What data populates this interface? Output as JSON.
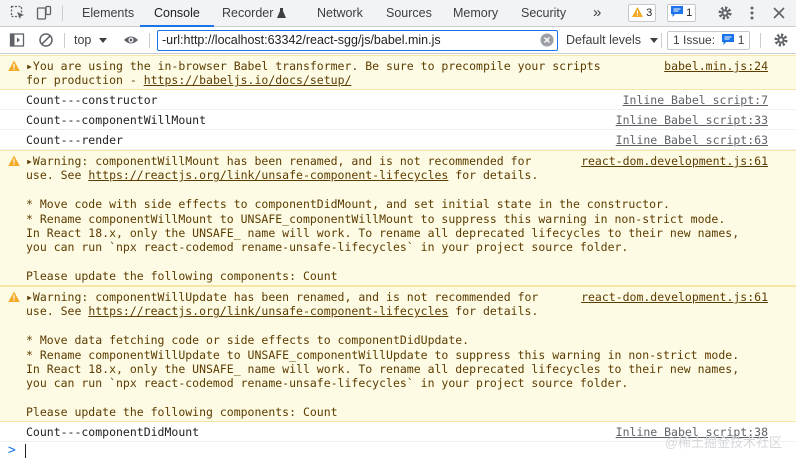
{
  "tabs": [
    {
      "label": "Elements"
    },
    {
      "label": "Console"
    },
    {
      "label": "Recorder"
    },
    {
      "label": "Network"
    },
    {
      "label": "Sources"
    },
    {
      "label": "Memory"
    },
    {
      "label": "Security"
    }
  ],
  "badges": {
    "warnings": "3",
    "messages": "1"
  },
  "toolbar": {
    "context": "top",
    "filter_value": "-url:http://localhost:63342/react-sgg/js/babel.min.js",
    "levels_label": "Default levels",
    "issue_label": "1 Issue:",
    "issue_count": "1"
  },
  "messages": [
    {
      "type": "warn",
      "lines": [
        "▸You are using the in-browser Babel transformer. Be sure to precompile your scripts",
        "for production - "
      ],
      "link": "https://babeljs.io/docs/setup/",
      "source": "babel.min.js:24"
    },
    {
      "type": "log",
      "text": "Count---constructor",
      "source": "Inline Babel script:7"
    },
    {
      "type": "log",
      "text": "Count---componentWillMount",
      "source": "Inline Babel script:33"
    },
    {
      "type": "log",
      "text": "Count---render",
      "source": "Inline Babel script:63"
    },
    {
      "type": "warn",
      "head": "▸Warning: componentWillMount has been renamed, and is not recommended for",
      "use_pre": "use. See ",
      "link": "https://reactjs.org/link/unsafe-component-lifecycles",
      "use_post": " for details.",
      "body": [
        "",
        "* Move code with side effects to componentDidMount, and set initial state in the constructor.",
        "* Rename componentWillMount to UNSAFE_componentWillMount to suppress this warning in non-strict mode.",
        "In React 18.x, only the UNSAFE_ name will work. To rename all deprecated lifecycles to their new names,",
        "you can run `npx react-codemod rename-unsafe-lifecycles` in your project source folder.",
        "",
        "Please update the following components: Count"
      ],
      "source": "react-dom.development.js:61"
    },
    {
      "type": "warn",
      "head": "▸Warning: componentWillUpdate has been renamed, and is not recommended for",
      "use_pre": "use. See ",
      "link": "https://reactjs.org/link/unsafe-component-lifecycles",
      "use_post": " for details.",
      "body": [
        "",
        "* Move data fetching code or side effects to componentDidUpdate.",
        "* Rename componentWillUpdate to UNSAFE_componentWillUpdate to suppress this warning in non-strict mode.",
        "In React 18.x, only the UNSAFE_ name will work. To rename all deprecated lifecycles to their new names,",
        "you can run `npx react-codemod rename-unsafe-lifecycles` in your project source folder.",
        "",
        "Please update the following components: Count"
      ],
      "source": "react-dom.development.js:61"
    },
    {
      "type": "log",
      "text": "Count---componentDidMount",
      "source": "Inline Babel script:38"
    }
  ],
  "prompt": ">",
  "watermark": "@稀土掘金技术社区",
  "colors": {
    "accent": "#1a73e8",
    "warn_bg": "#fefbe4",
    "warn_text": "#5c3c00",
    "warn_icon": "#f2ab26"
  },
  "icons": [
    "inspect-element-icon",
    "device-toolbar-icon",
    "recorder-flask-icon",
    "more-tabs-icon",
    "settings-gear-icon",
    "more-options-icon",
    "toggle-sidebar-icon",
    "clear-console-icon",
    "eye-icon",
    "clear-filter-icon",
    "warning-icon",
    "chevron-down-icon"
  ]
}
